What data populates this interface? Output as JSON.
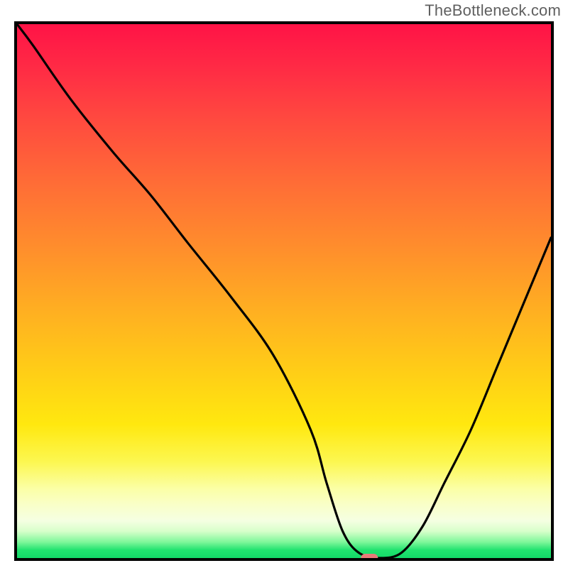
{
  "watermark": "TheBottleneck.com",
  "chart_data": {
    "type": "line",
    "title": "",
    "xlabel": "",
    "ylabel": "",
    "xlim": [
      0,
      100
    ],
    "ylim": [
      0,
      100
    ],
    "grid": false,
    "legend": false,
    "background": {
      "type": "vertical-gradient",
      "stops": [
        {
          "pos": 0,
          "color": "#ff1346"
        },
        {
          "pos": 30,
          "color": "#ff6d36"
        },
        {
          "pos": 66,
          "color": "#ffd016"
        },
        {
          "pos": 90,
          "color": "#f9ffc8"
        },
        {
          "pos": 100,
          "color": "#13d768"
        }
      ]
    },
    "series": [
      {
        "name": "bottleneck-curve",
        "color": "#000000",
        "x": [
          0,
          3,
          10,
          18,
          25,
          32,
          40,
          48,
          55,
          58,
          61,
          64,
          68,
          72,
          76,
          80,
          85,
          90,
          95,
          100
        ],
        "y": [
          100,
          96,
          86,
          76,
          68,
          59,
          49,
          38,
          24,
          14,
          5,
          1,
          0,
          1,
          6,
          14,
          24,
          36,
          48,
          60
        ]
      }
    ],
    "marker": {
      "name": "optimal-point",
      "shape": "rounded-rect",
      "x": 66,
      "y": 0,
      "width_pct": 3.2,
      "height_pct": 1.6,
      "color": "#e77a79"
    }
  }
}
